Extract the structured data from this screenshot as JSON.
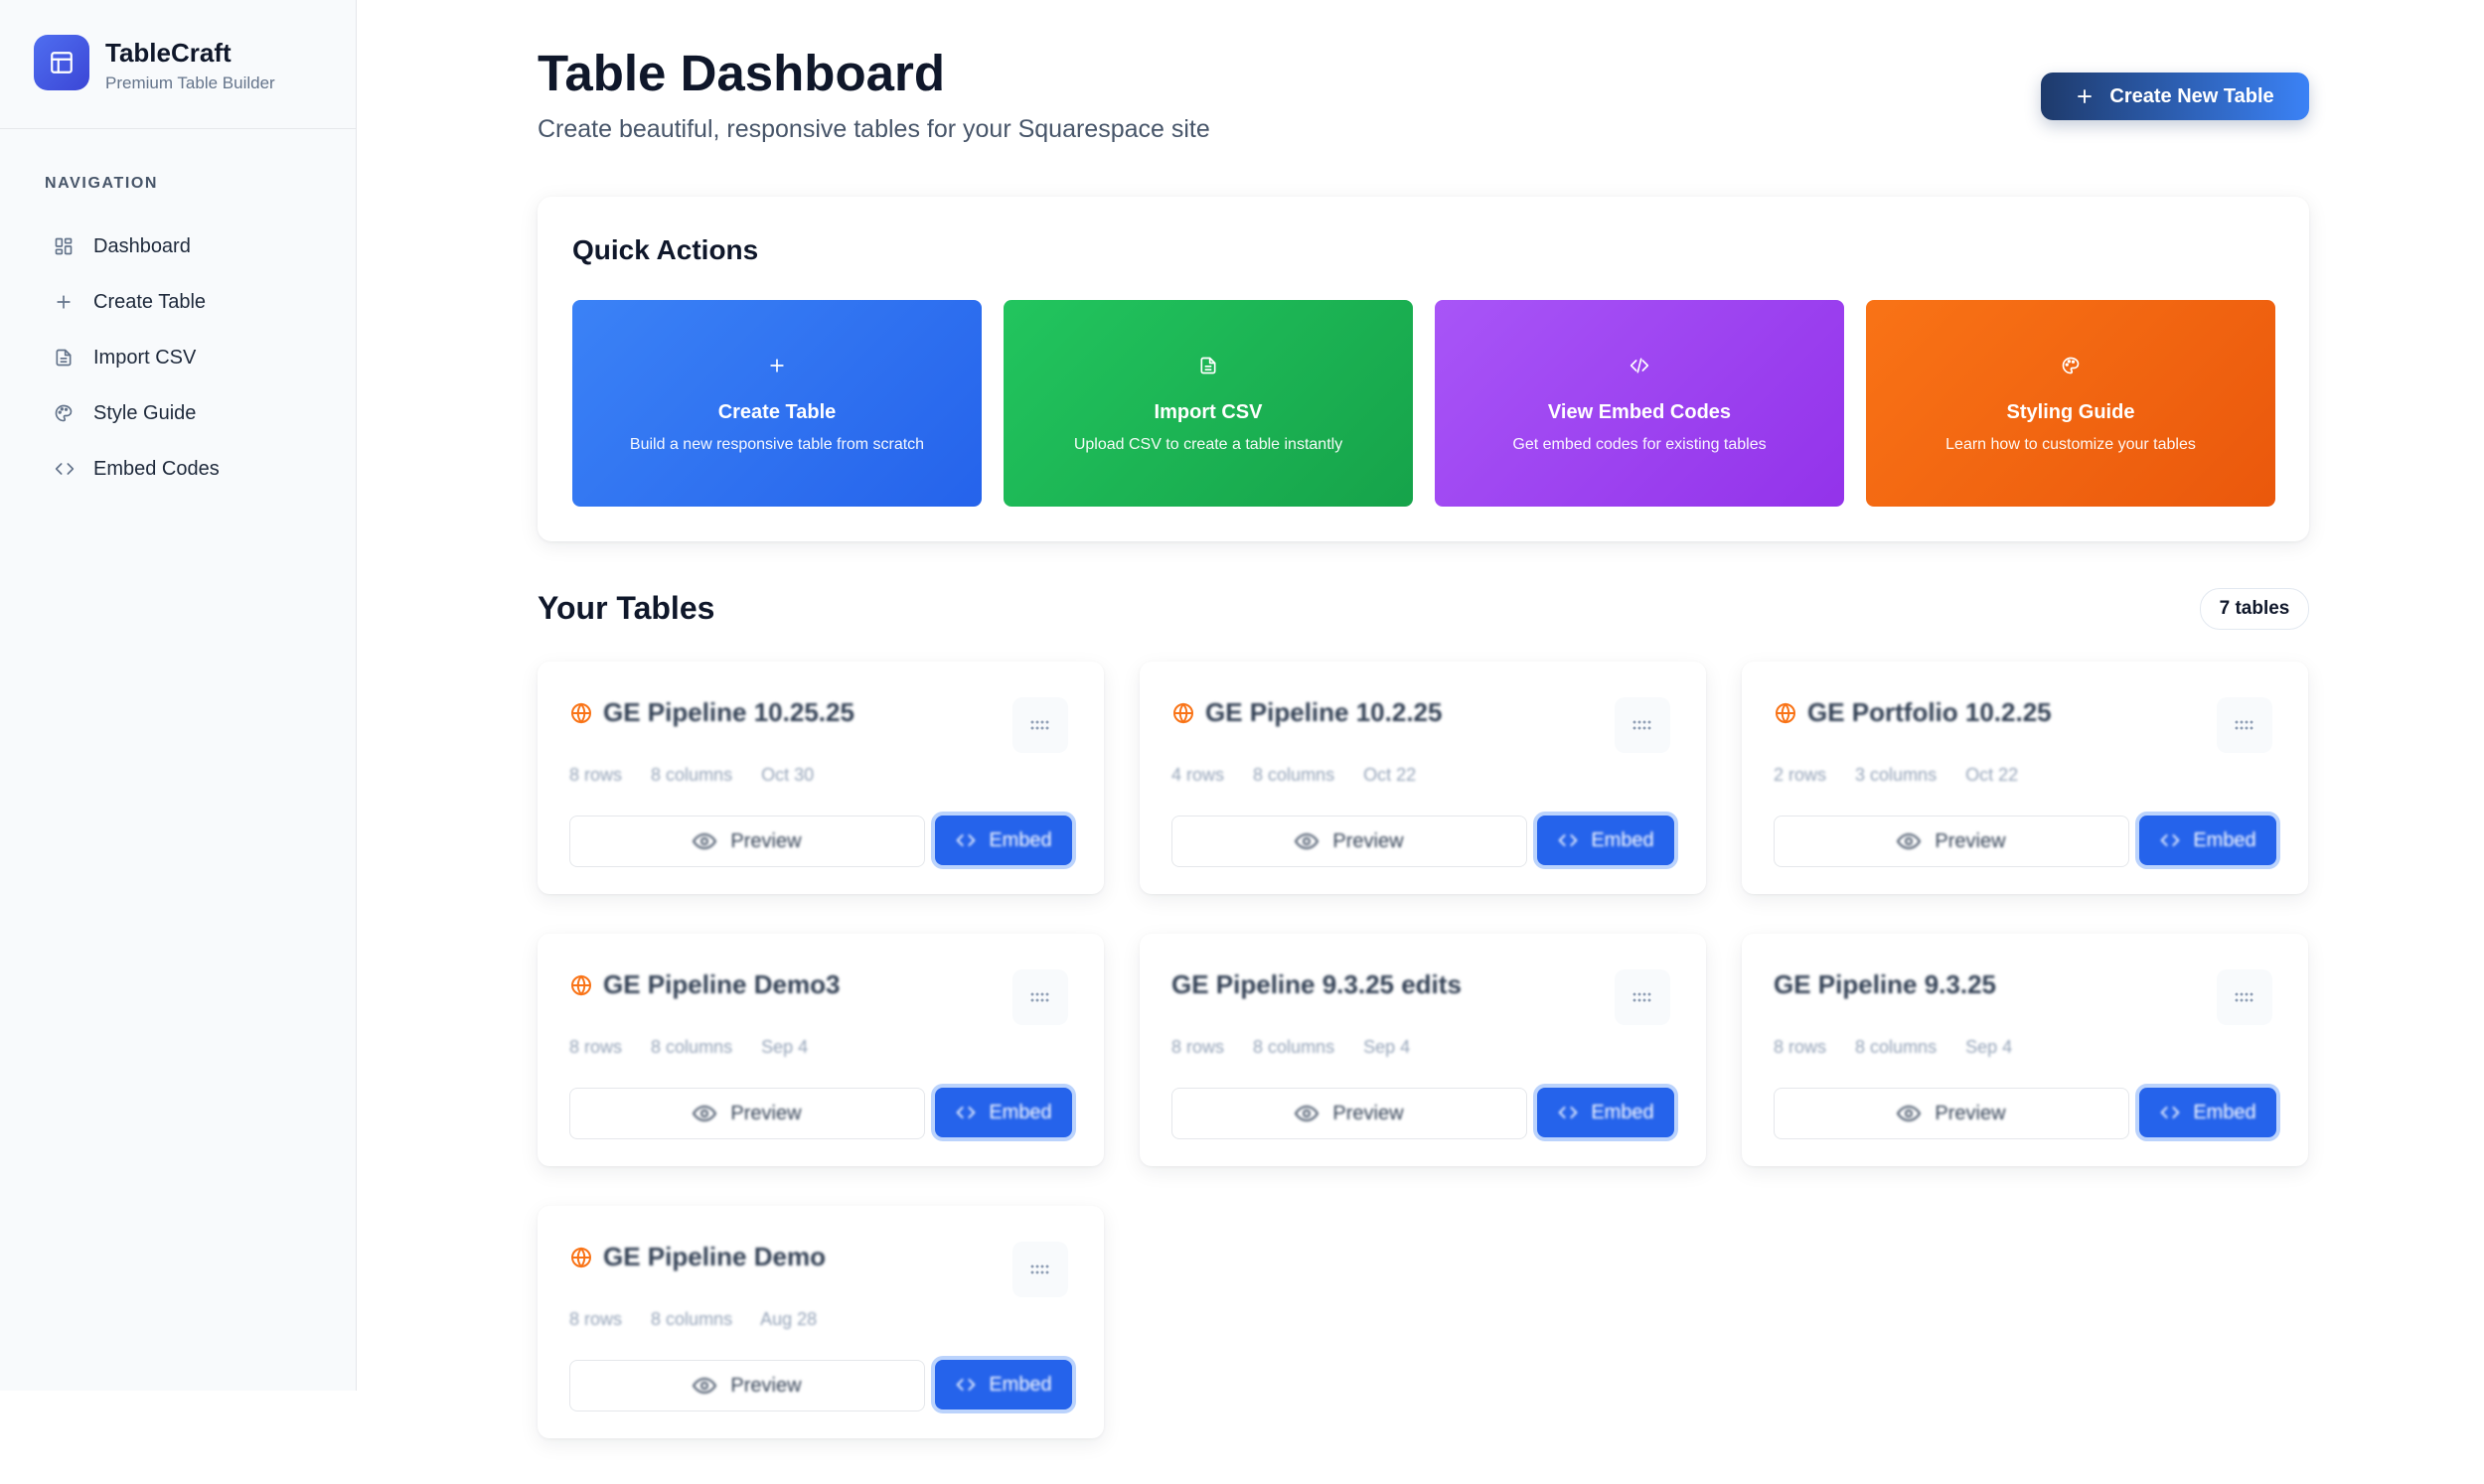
{
  "brand": {
    "name": "TableCraft",
    "subtitle": "Premium Table Builder"
  },
  "nav": {
    "title": "NAVIGATION",
    "items": [
      {
        "label": "Dashboard",
        "icon": "dashboard-icon"
      },
      {
        "label": "Create Table",
        "icon": "plus-icon"
      },
      {
        "label": "Import CSV",
        "icon": "file-icon"
      },
      {
        "label": "Style Guide",
        "icon": "palette-icon"
      },
      {
        "label": "Embed Codes",
        "icon": "code-icon"
      }
    ]
  },
  "header": {
    "title": "Table Dashboard",
    "subtitle": "Create beautiful, responsive tables for your Squarespace site",
    "create_button": "Create New Table"
  },
  "quick_actions": {
    "title": "Quick Actions",
    "items": [
      {
        "title": "Create Table",
        "desc": "Build a new responsive table from scratch",
        "icon": "plus-icon",
        "color_from": "#3b82f6",
        "color_to": "#2563eb"
      },
      {
        "title": "Import CSV",
        "desc": "Upload CSV to create a table instantly",
        "icon": "file-icon",
        "color_from": "#22c55e",
        "color_to": "#16a34a"
      },
      {
        "title": "View Embed Codes",
        "desc": "Get embed codes for existing tables",
        "icon": "code-icon",
        "color_from": "#a855f7",
        "color_to": "#9333ea"
      },
      {
        "title": "Styling Guide",
        "desc": "Learn how to customize your tables",
        "icon": "palette-icon",
        "color_from": "#f97316",
        "color_to": "#ea580c"
      }
    ]
  },
  "tables": {
    "title": "Your Tables",
    "count": "7 tables",
    "preview_label": "Preview",
    "embed_label": "Embed",
    "items": [
      {
        "name": "GE Pipeline 10.25.25",
        "rows": "8 rows",
        "cols": "8 columns",
        "date": "Oct 30",
        "globe": true
      },
      {
        "name": "GE Pipeline 10.2.25",
        "rows": "4 rows",
        "cols": "8 columns",
        "date": "Oct 22",
        "globe": true
      },
      {
        "name": "GE Portfolio 10.2.25",
        "rows": "2 rows",
        "cols": "3 columns",
        "date": "Oct 22",
        "globe": true
      },
      {
        "name": "GE Pipeline Demo3",
        "rows": "8 rows",
        "cols": "8 columns",
        "date": "Sep 4",
        "globe": true
      },
      {
        "name": "GE Pipeline 9.3.25 edits",
        "rows": "8 rows",
        "cols": "8 columns",
        "date": "Sep 4",
        "globe": false
      },
      {
        "name": "GE Pipeline 9.3.25",
        "rows": "8 rows",
        "cols": "8 columns",
        "date": "Sep 4",
        "globe": false
      },
      {
        "name": "GE Pipeline Demo",
        "rows": "8 rows",
        "cols": "8 columns",
        "date": "Aug 28",
        "globe": true
      }
    ]
  }
}
